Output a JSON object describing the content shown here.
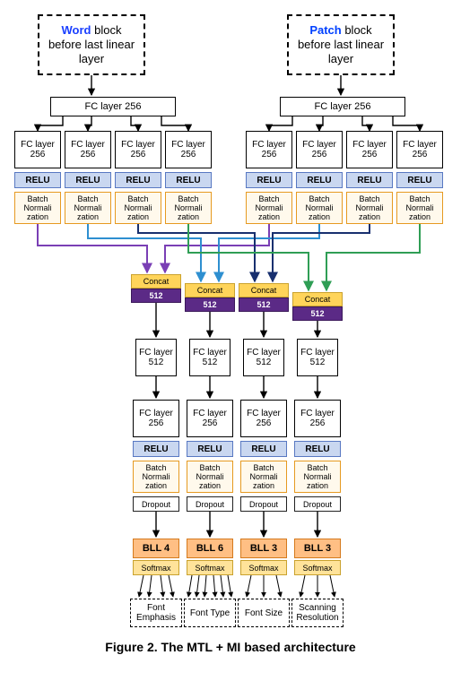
{
  "inputs": {
    "word": {
      "highlight": "Word",
      "rest": " block before last linear layer"
    },
    "patch": {
      "highlight": "Patch",
      "rest": " block before last linear layer"
    }
  },
  "fcwide_label": "FC layer 256",
  "branch_block": {
    "fc": "FC layer 256",
    "relu": "RELU",
    "bn": "Batch Normali zation"
  },
  "concat": {
    "label": "Concat",
    "size": "512"
  },
  "fc512_label": "FC layer 512",
  "lower_block": {
    "fc": "FC layer 256",
    "relu": "RELU",
    "bn": "Batch Normali zation",
    "dropout": "Dropout"
  },
  "bll": [
    "BLL 4",
    "BLL 6",
    "BLL 3",
    "BLL 3"
  ],
  "softmax_label": "Softmax",
  "targets": [
    "Font Emphasis",
    "Font Type",
    "Font Size",
    "Scanning Resolution"
  ],
  "caption": "Figure 2. The MTL + MI based architecture",
  "colors": {
    "path1": "#7a3fb5",
    "path2": "#2e8fd0",
    "path3": "#18306f",
    "path4": "#2f9e55"
  },
  "chart_data": {
    "type": "diagram",
    "description": "Multi-task learning architecture. Two input feature blocks (Word and Patch, each the activations before the last linear layer) each pass through an FC-256 layer, then fan out into 4 parallel FC-256 → ReLU → BatchNorm branches (so 4 word-side and 4 patch-side branches). The i-th word branch is concatenated with the i-th patch branch (Concat → 512). Each concatenated 512-dim vector goes through FC-512, then FC-256 → ReLU → BatchNorm → Dropout, then a task-specific final linear layer (BLL) with Softmax.",
    "tasks": [
      {
        "name": "Font Emphasis",
        "output_classes": 4
      },
      {
        "name": "Font Type",
        "output_classes": 6
      },
      {
        "name": "Font Size",
        "output_classes": 3
      },
      {
        "name": "Scanning Resolution",
        "output_classes": 3
      }
    ],
    "shared_layers": {
      "per_input_fc": 256,
      "per_branch_fc": 256,
      "concat_dim": 512,
      "post_concat_fc1": 512,
      "post_concat_fc2": 256
    }
  }
}
